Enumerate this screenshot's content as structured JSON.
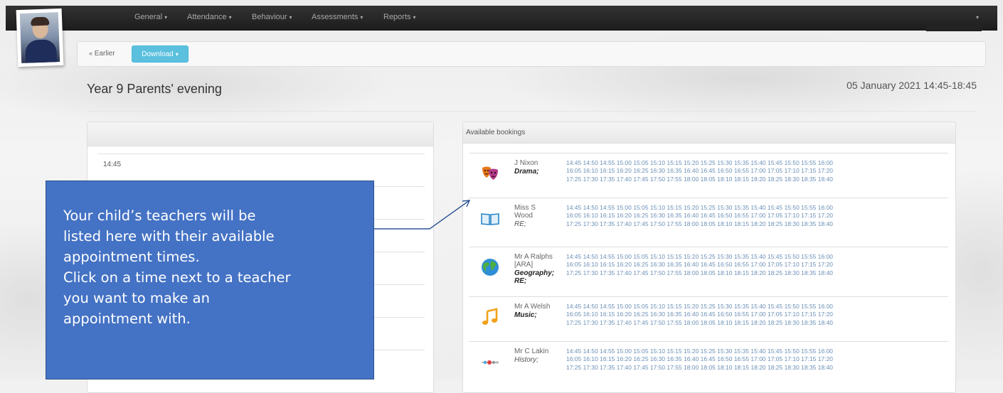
{
  "navbar": {
    "items": [
      {
        "label": "General"
      },
      {
        "label": "Attendance"
      },
      {
        "label": "Behaviour"
      },
      {
        "label": "Assessments"
      },
      {
        "label": "Reports"
      }
    ],
    "caret": "▾"
  },
  "toolbar": {
    "earlier_label": "Earlier",
    "earlier_icon": "double-chevron-left-icon",
    "download_label": "Download",
    "accent": "#5bc0de"
  },
  "page": {
    "title": "Year 9 Parents' evening",
    "date": "05 January 2021 14:45-18:45"
  },
  "left_panel": {
    "first_time": "14:45"
  },
  "bookings": {
    "header": "Available bookings",
    "slot_color": "#6a8fb5",
    "slot_lines": [
      "14:45 14:50 14:55 15:00 15:05 15:10 15:15 15:20 15:25 15:30 15:35 15:40 15:45 15:50 15:55 16:00",
      "16:05 16:10 16:15 16:20 16:25 16:30 16:35 16:40 16:45 16:50 16:55 17:00 17:05 17:10 17:15 17:20",
      "17:25 17:30 17:35 17:40 17:45 17:50 17:55 18:00 18:05 18:10 18:15 18:20 18:25 18:30 18:35 18:40"
    ],
    "teachers": [
      {
        "name": "J Nixon",
        "subject": "Drama;",
        "icon": "theatre-masks-icon"
      },
      {
        "name": "Miss S Wood",
        "subject": "RE;",
        "icon": "open-book-icon"
      },
      {
        "name": "Mr A Ralphs [ARA]",
        "subject": "Geography;",
        "subject2": "RE;",
        "icon": "globe-icon"
      },
      {
        "name": "Mr A Welsh",
        "subject": "Music;",
        "icon": "music-note-icon"
      },
      {
        "name": "Mr C Lakin",
        "subject": "History;",
        "icon": "history-timeline-icon"
      }
    ]
  },
  "callout": {
    "lines": [
      "Your child’s teachers will be",
      "listed here with their available",
      "appointment times.",
      "Click on a time next to a teacher",
      "you want to make an",
      "appointment with."
    ],
    "color": "#4472c4"
  }
}
